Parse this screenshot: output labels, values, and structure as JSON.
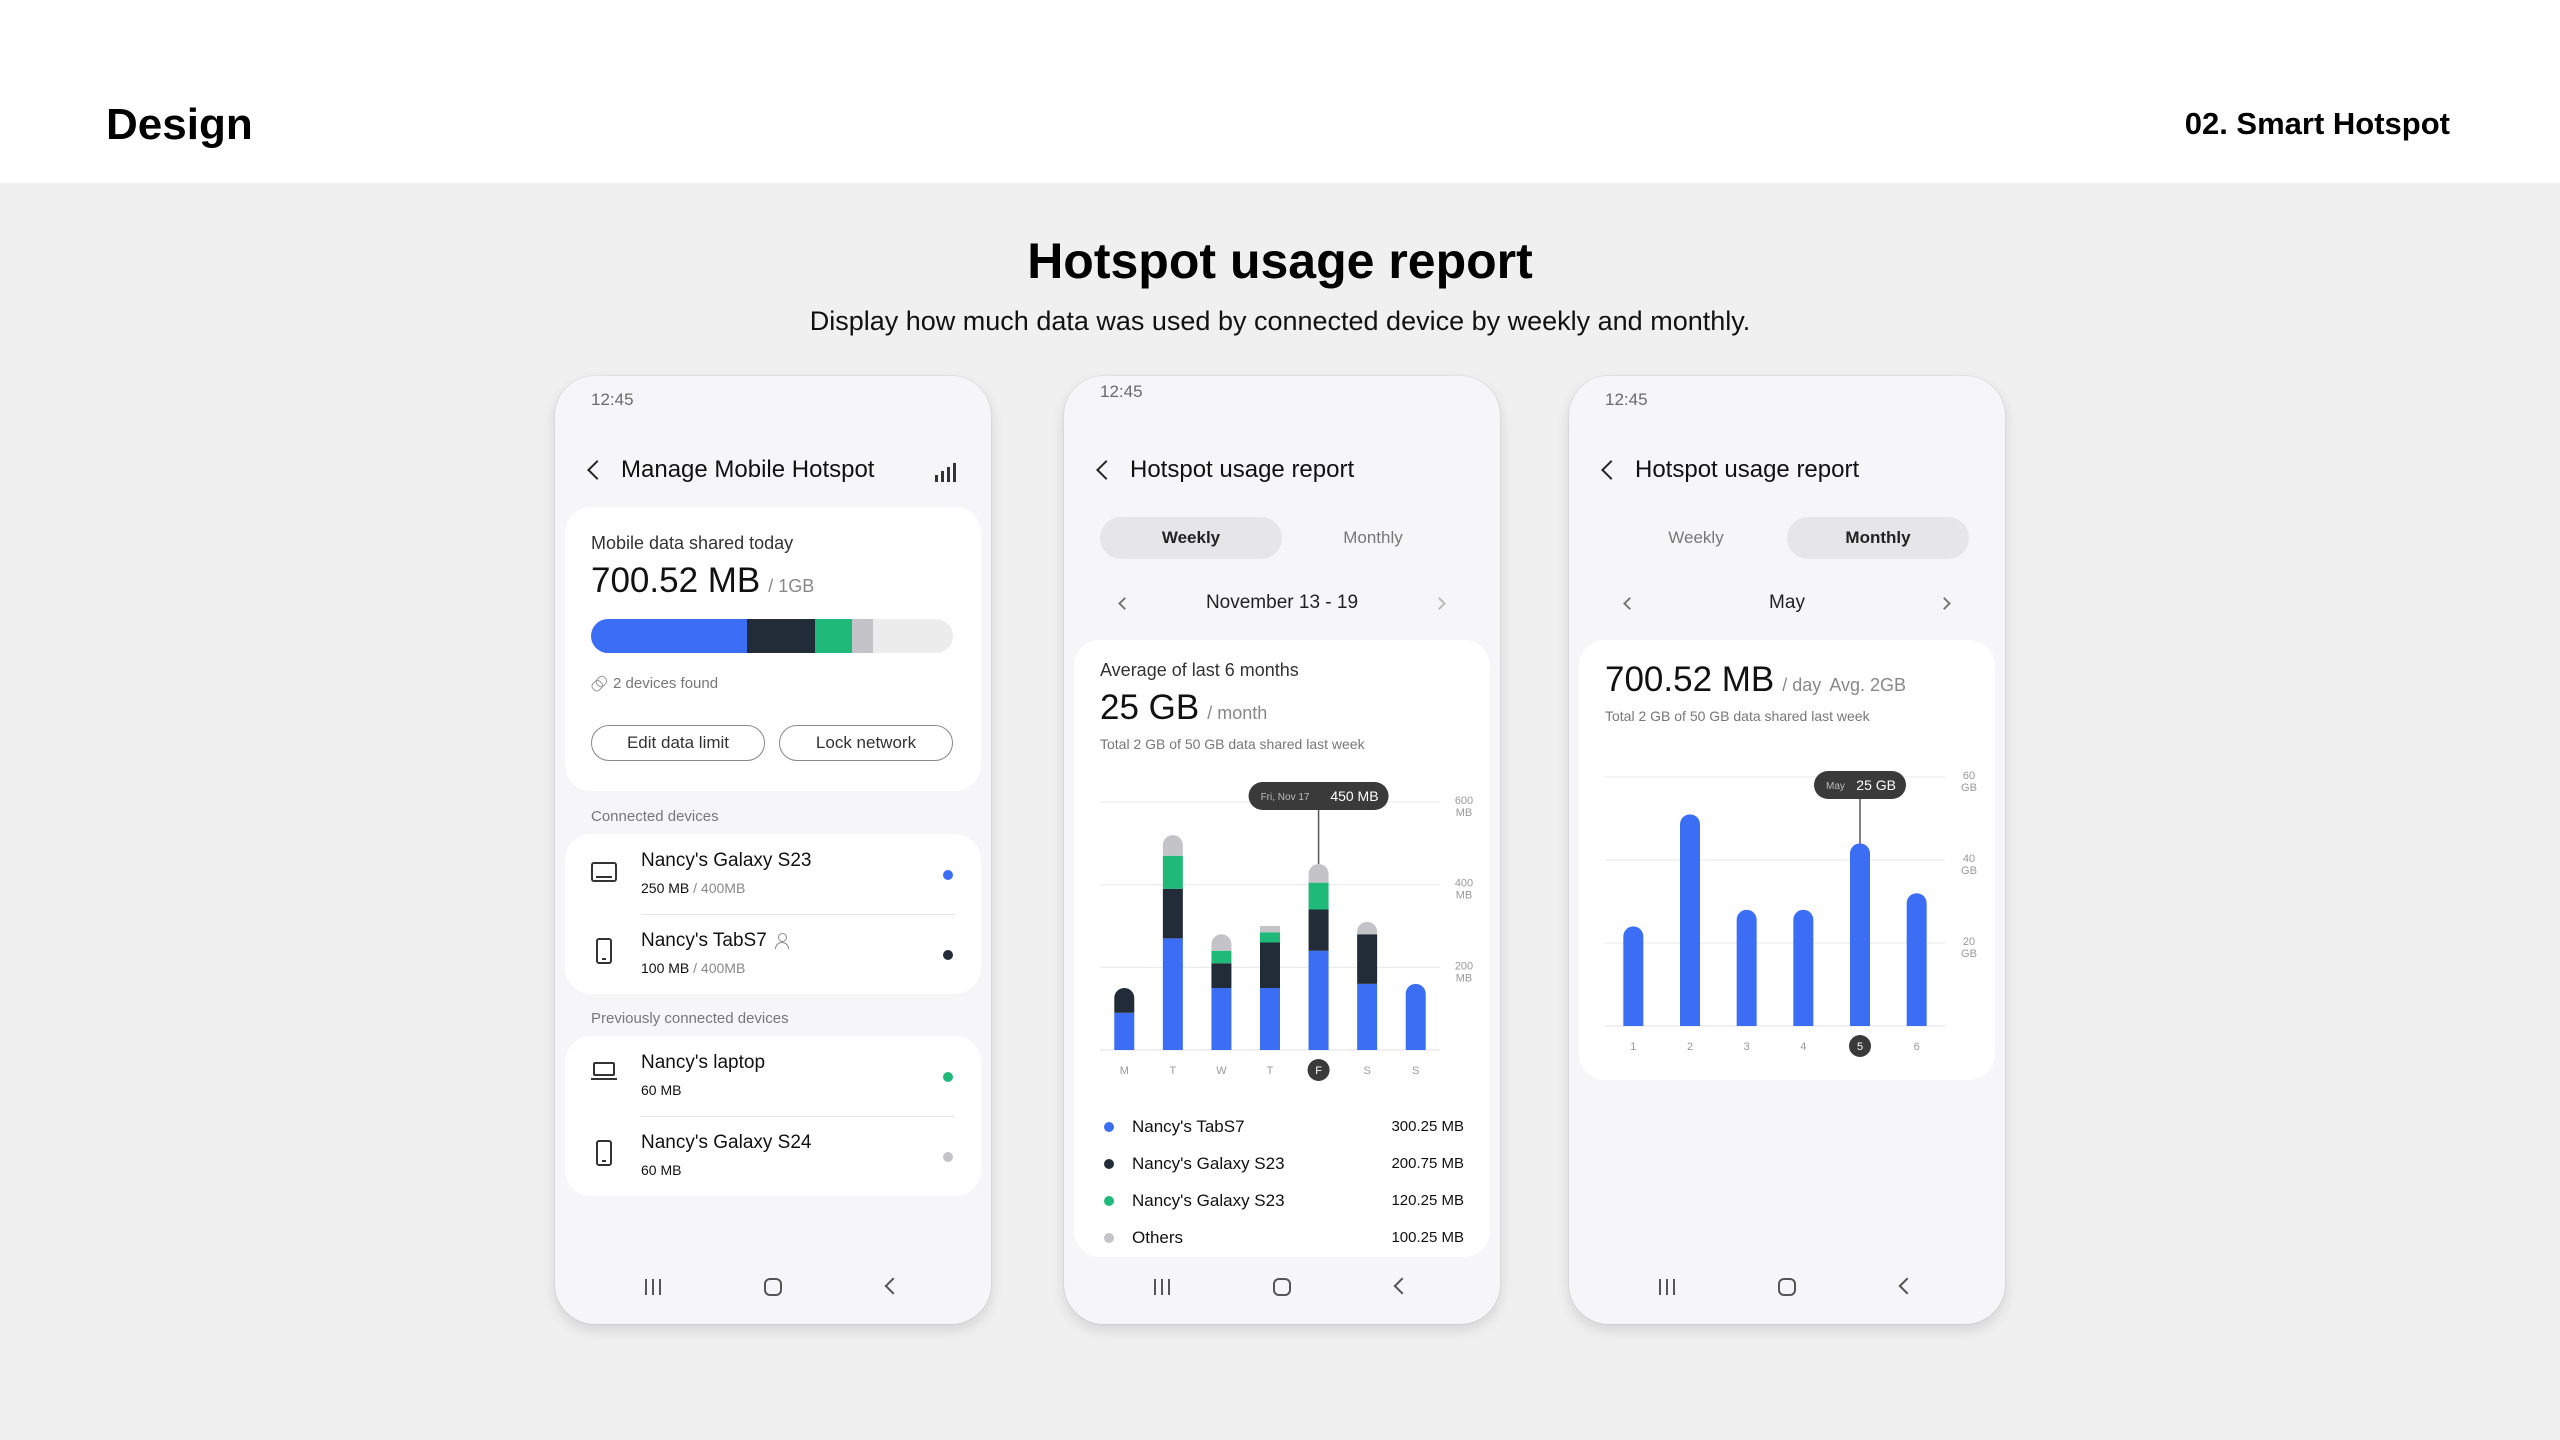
{
  "header": {
    "brand": "Design",
    "section": "02. Smart Hotspot"
  },
  "title": "Hotspot usage report",
  "subtitle": "Display how much data was used by connected device by weekly and monthly.",
  "colors": {
    "blue": "#3b6ef5",
    "dark": "#222c38",
    "green": "#1fba7a",
    "gray": "#c4c4c8"
  },
  "phone1": {
    "time": "12:45",
    "title": "Manage Mobile Hotspot",
    "summary": {
      "label": "Mobile data shared today",
      "value": "700.52 MB",
      "limit": "/ 1GB",
      "bar_percent": {
        "blue": 43,
        "dark": 19,
        "green": 10,
        "gray": 6
      },
      "found": "2 devices found",
      "edit_label": "Edit data limit",
      "lock_label": "Lock network"
    },
    "connected_label": "Connected devices",
    "connected": [
      {
        "icon": "tablet-icon",
        "name": "Nancy's Galaxy S23",
        "used": "250 MB",
        "limit": "/ 400MB",
        "color": "#3b6ef5"
      },
      {
        "icon": "phone-icon",
        "name": "Nancy's TabS7",
        "used": "100 MB",
        "limit": "/ 400MB",
        "color": "#222c38"
      }
    ],
    "previous_label": "Previously connected devices",
    "previous": [
      {
        "icon": "laptop-icon",
        "name": "Nancy's laptop",
        "used": "60 MB",
        "color": "#1fba7a"
      },
      {
        "icon": "phone-icon",
        "name": "Nancy's Galaxy S24",
        "used": "60 MB",
        "color": "#c4c4c8"
      }
    ]
  },
  "phone2": {
    "time": "12:45",
    "title": "Hotspot usage report",
    "tabs": {
      "weekly": "Weekly",
      "monthly": "Monthly"
    },
    "active_tab": "weekly",
    "range": "November 13 - 19",
    "avg_label": "Average of last 6 months",
    "avg_value": "25 GB",
    "avg_unit": "/ month",
    "note": "Total 2 GB of 50 GB data shared last week",
    "tooltip": {
      "date": "Fri, Nov 17",
      "value": "450 MB"
    },
    "legend": [
      {
        "name": "Nancy's TabS7",
        "value": "300.25 MB",
        "color": "#3b6ef5"
      },
      {
        "name": "Nancy's Galaxy S23",
        "value": "200.75 MB",
        "color": "#222c38"
      },
      {
        "name": "Nancy's Galaxy S23",
        "value": "120.25 MB",
        "color": "#1fba7a"
      },
      {
        "name": "Others",
        "value": "100.25 MB",
        "color": "#c4c4c8"
      }
    ]
  },
  "phone3": {
    "time": "12:45",
    "title": "Hotspot usage report",
    "tabs": {
      "weekly": "Weekly",
      "monthly": "Monthly"
    },
    "active_tab": "monthly",
    "range": "May",
    "value": "700.52 MB",
    "unit": "/ day",
    "avg": "Avg. 2GB",
    "note": "Total 2 GB of 50 GB data shared last week",
    "tooltip": {
      "month": "May",
      "value": "25 GB"
    }
  },
  "chart_data": [
    {
      "type": "bar",
      "stacked": true,
      "categories": [
        "M",
        "T",
        "W",
        "T",
        "F",
        "S",
        "S"
      ],
      "selected_index": 4,
      "series": [
        {
          "name": "Nancy's TabS7",
          "values": [
            90,
            270,
            150,
            150,
            240,
            160,
            160
          ]
        },
        {
          "name": "Nancy's Galaxy S23",
          "values": [
            60,
            120,
            60,
            110,
            100,
            120,
            0
          ]
        },
        {
          "name": "Nancy's Galaxy S23",
          "values": [
            0,
            80,
            30,
            25,
            65,
            0,
            0
          ]
        },
        {
          "name": "Others",
          "values": [
            0,
            50,
            40,
            15,
            45,
            30,
            0
          ]
        }
      ],
      "yticks": [
        "600 MB",
        "400 MB",
        "200 MB"
      ],
      "ylim": [
        0,
        600
      ],
      "grid": true
    },
    {
      "type": "bar",
      "categories": [
        "1",
        "2",
        "3",
        "4",
        "5",
        "6"
      ],
      "selected_index": 4,
      "values": [
        24,
        51,
        28,
        28,
        44,
        32
      ],
      "yticks": [
        "60 GB",
        "40 GB",
        "20 GB"
      ],
      "ylim": [
        0,
        60
      ],
      "grid": true
    }
  ]
}
